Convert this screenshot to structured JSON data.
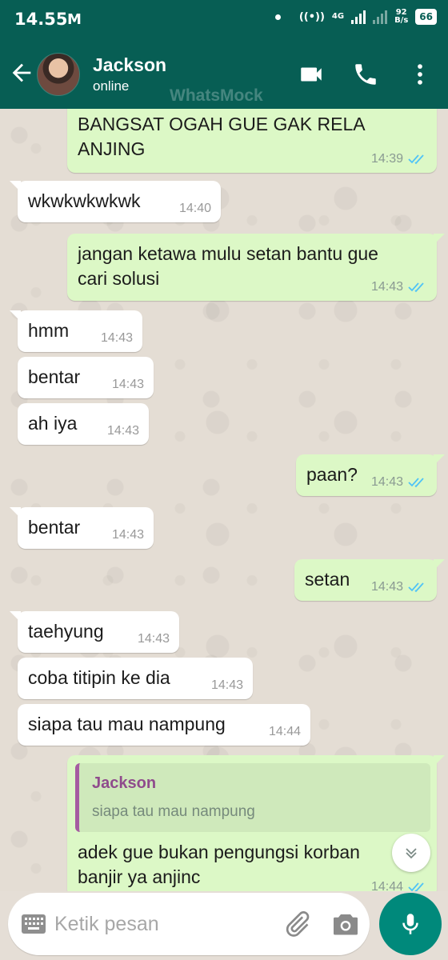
{
  "status_bar": {
    "time": "14.55",
    "mail_indicator": "M",
    "network_label": "4G",
    "data_rate": "92",
    "data_rate_unit": "B/s",
    "battery": "66",
    "icons": [
      "mail-icon",
      "notification-dot-icon",
      "hotspot-icon",
      "signal-icon",
      "signal-icon",
      "battery-icon"
    ]
  },
  "header": {
    "contact_name": "Jackson",
    "contact_status": "online",
    "watermark": "WhatsMock",
    "icons": [
      "back-arrow-icon",
      "video-call-icon",
      "voice-call-icon",
      "more-options-icon"
    ]
  },
  "colors": {
    "header_bg": "#075e54",
    "outgoing_bubble": "#dcf8c6",
    "incoming_bubble": "#ffffff",
    "read_tick": "#4fc3f7",
    "quote_accent": "#a55ca1",
    "mic_button": "#00897b"
  },
  "messages": [
    {
      "direction": "out",
      "lines": [
        "BANGSAT OGAH GUE GAK RELA",
        "ANJING"
      ],
      "time": "14:39",
      "status": "read"
    },
    {
      "direction": "in",
      "lines": [
        "wkwkwkwkwk"
      ],
      "time": "14:40"
    },
    {
      "direction": "out",
      "lines": [
        "jangan ketawa mulu setan bantu gue",
        "cari solusi"
      ],
      "time": "14:43",
      "status": "read"
    },
    {
      "direction": "in",
      "lines": [
        "hmm"
      ],
      "time": "14:43"
    },
    {
      "direction": "in",
      "lines": [
        "bentar"
      ],
      "time": "14:43"
    },
    {
      "direction": "in",
      "lines": [
        "ah iya"
      ],
      "time": "14:43"
    },
    {
      "direction": "out",
      "lines": [
        "paan?"
      ],
      "time": "14:43",
      "status": "read"
    },
    {
      "direction": "in",
      "lines": [
        "bentar"
      ],
      "time": "14:43"
    },
    {
      "direction": "out",
      "lines": [
        "setan"
      ],
      "time": "14:43",
      "status": "read"
    },
    {
      "direction": "in",
      "lines": [
        "taehyung"
      ],
      "time": "14:43"
    },
    {
      "direction": "in",
      "lines": [
        "coba titipin ke dia"
      ],
      "time": "14:43"
    },
    {
      "direction": "in",
      "lines": [
        "siapa tau mau nampung"
      ],
      "time": "14:44"
    },
    {
      "direction": "out",
      "quote": {
        "author": "Jackson",
        "text": "siapa tau mau nampung"
      },
      "lines": [
        "adek gue bukan pengungsi korban",
        "banjir ya anjinc"
      ],
      "time": "14:44",
      "status": "read"
    }
  ],
  "input": {
    "placeholder": "Ketik pesan",
    "icons": [
      "keyboard-icon",
      "attach-icon",
      "camera-icon",
      "mic-icon",
      "scroll-down-icon"
    ]
  }
}
